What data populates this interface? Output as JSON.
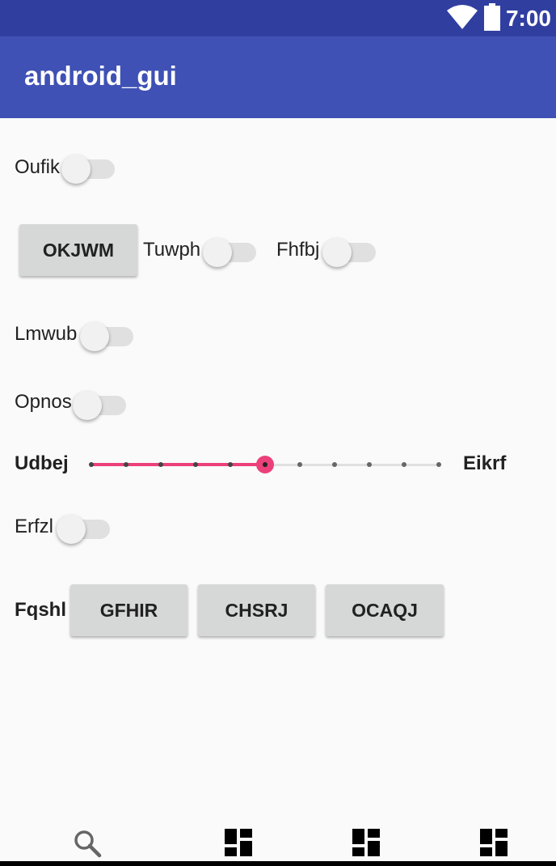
{
  "status_bar": {
    "time": "7:00",
    "icons": [
      "wifi-icon",
      "battery-icon"
    ]
  },
  "app_bar": {
    "title": "android_gui"
  },
  "rows": {
    "oufik": {
      "label": "Oufik",
      "checked": false
    },
    "okjwm_button": "OKJWM",
    "tuwph": {
      "label": "Tuwph",
      "checked": false
    },
    "fhfbj": {
      "label": "Fhfbj",
      "checked": false
    },
    "lmwub": {
      "label": "Lmwub",
      "checked": false
    },
    "opnos": {
      "label": "Opnos",
      "checked": false
    },
    "slider": {
      "left_label": "Udbej",
      "right_label": "Eikrf",
      "steps": 10,
      "value": 5
    },
    "erfzl": {
      "label": "Erfzl",
      "checked": false
    },
    "fqshl": {
      "label": "Fqshl",
      "buttons": [
        "GFHIR",
        "CHSRJ",
        "OCAQJ"
      ]
    }
  },
  "bottom_nav": {
    "items": [
      "search-icon",
      "dashboard-icon",
      "dashboard-icon",
      "dashboard-icon"
    ]
  },
  "colors": {
    "status_bar": "#303f9f",
    "app_bar": "#3f51b5",
    "accent": "#ec407a",
    "background": "#fafafa"
  }
}
